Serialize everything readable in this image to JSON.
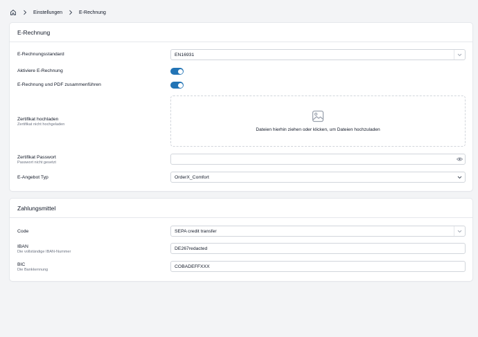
{
  "breadcrumb": {
    "home_icon": "home-icon",
    "items": [
      "Einstellungen",
      "E-Rechnung"
    ]
  },
  "erechnung": {
    "title": "E-Rechnung",
    "standard": {
      "label": "E-Rechnungsstandard",
      "value": "EN16931"
    },
    "aktiviere": {
      "label": "Aktiviere E-Rechnung",
      "on": true
    },
    "merge_pdf": {
      "label": "E-Rechnung und PDF zusammenführen",
      "on": true
    },
    "zertifikat": {
      "label": "Zertifikat hochladen",
      "sublabel": "Zertifikat nicht hochgeladen",
      "dropzone_text": "Dateien hierhin ziehen oder klicken, um Dateien hochzuladen"
    },
    "passwort": {
      "label": "Zertifikat Passwort",
      "sublabel": "Passwort nicht gesetzt",
      "value": ""
    },
    "angebot_typ": {
      "label": "E-Angebot Typ",
      "value": "OrderX_Comfort"
    }
  },
  "zahlungsmittel": {
    "title": "Zahlungsmittel",
    "code": {
      "label": "Code",
      "value": "SEPA credit transfer"
    },
    "iban": {
      "label": "IBAN",
      "sublabel": "Die vollständige IBAN-Nummer",
      "value": "DE267redacted"
    },
    "bic": {
      "label": "BIC",
      "sublabel": "Die Bankkennung",
      "value": "COBADEFFXXX"
    }
  },
  "colors": {
    "accent": "#2274b5",
    "border": "#d1d5db",
    "background": "#f3f4f6"
  }
}
